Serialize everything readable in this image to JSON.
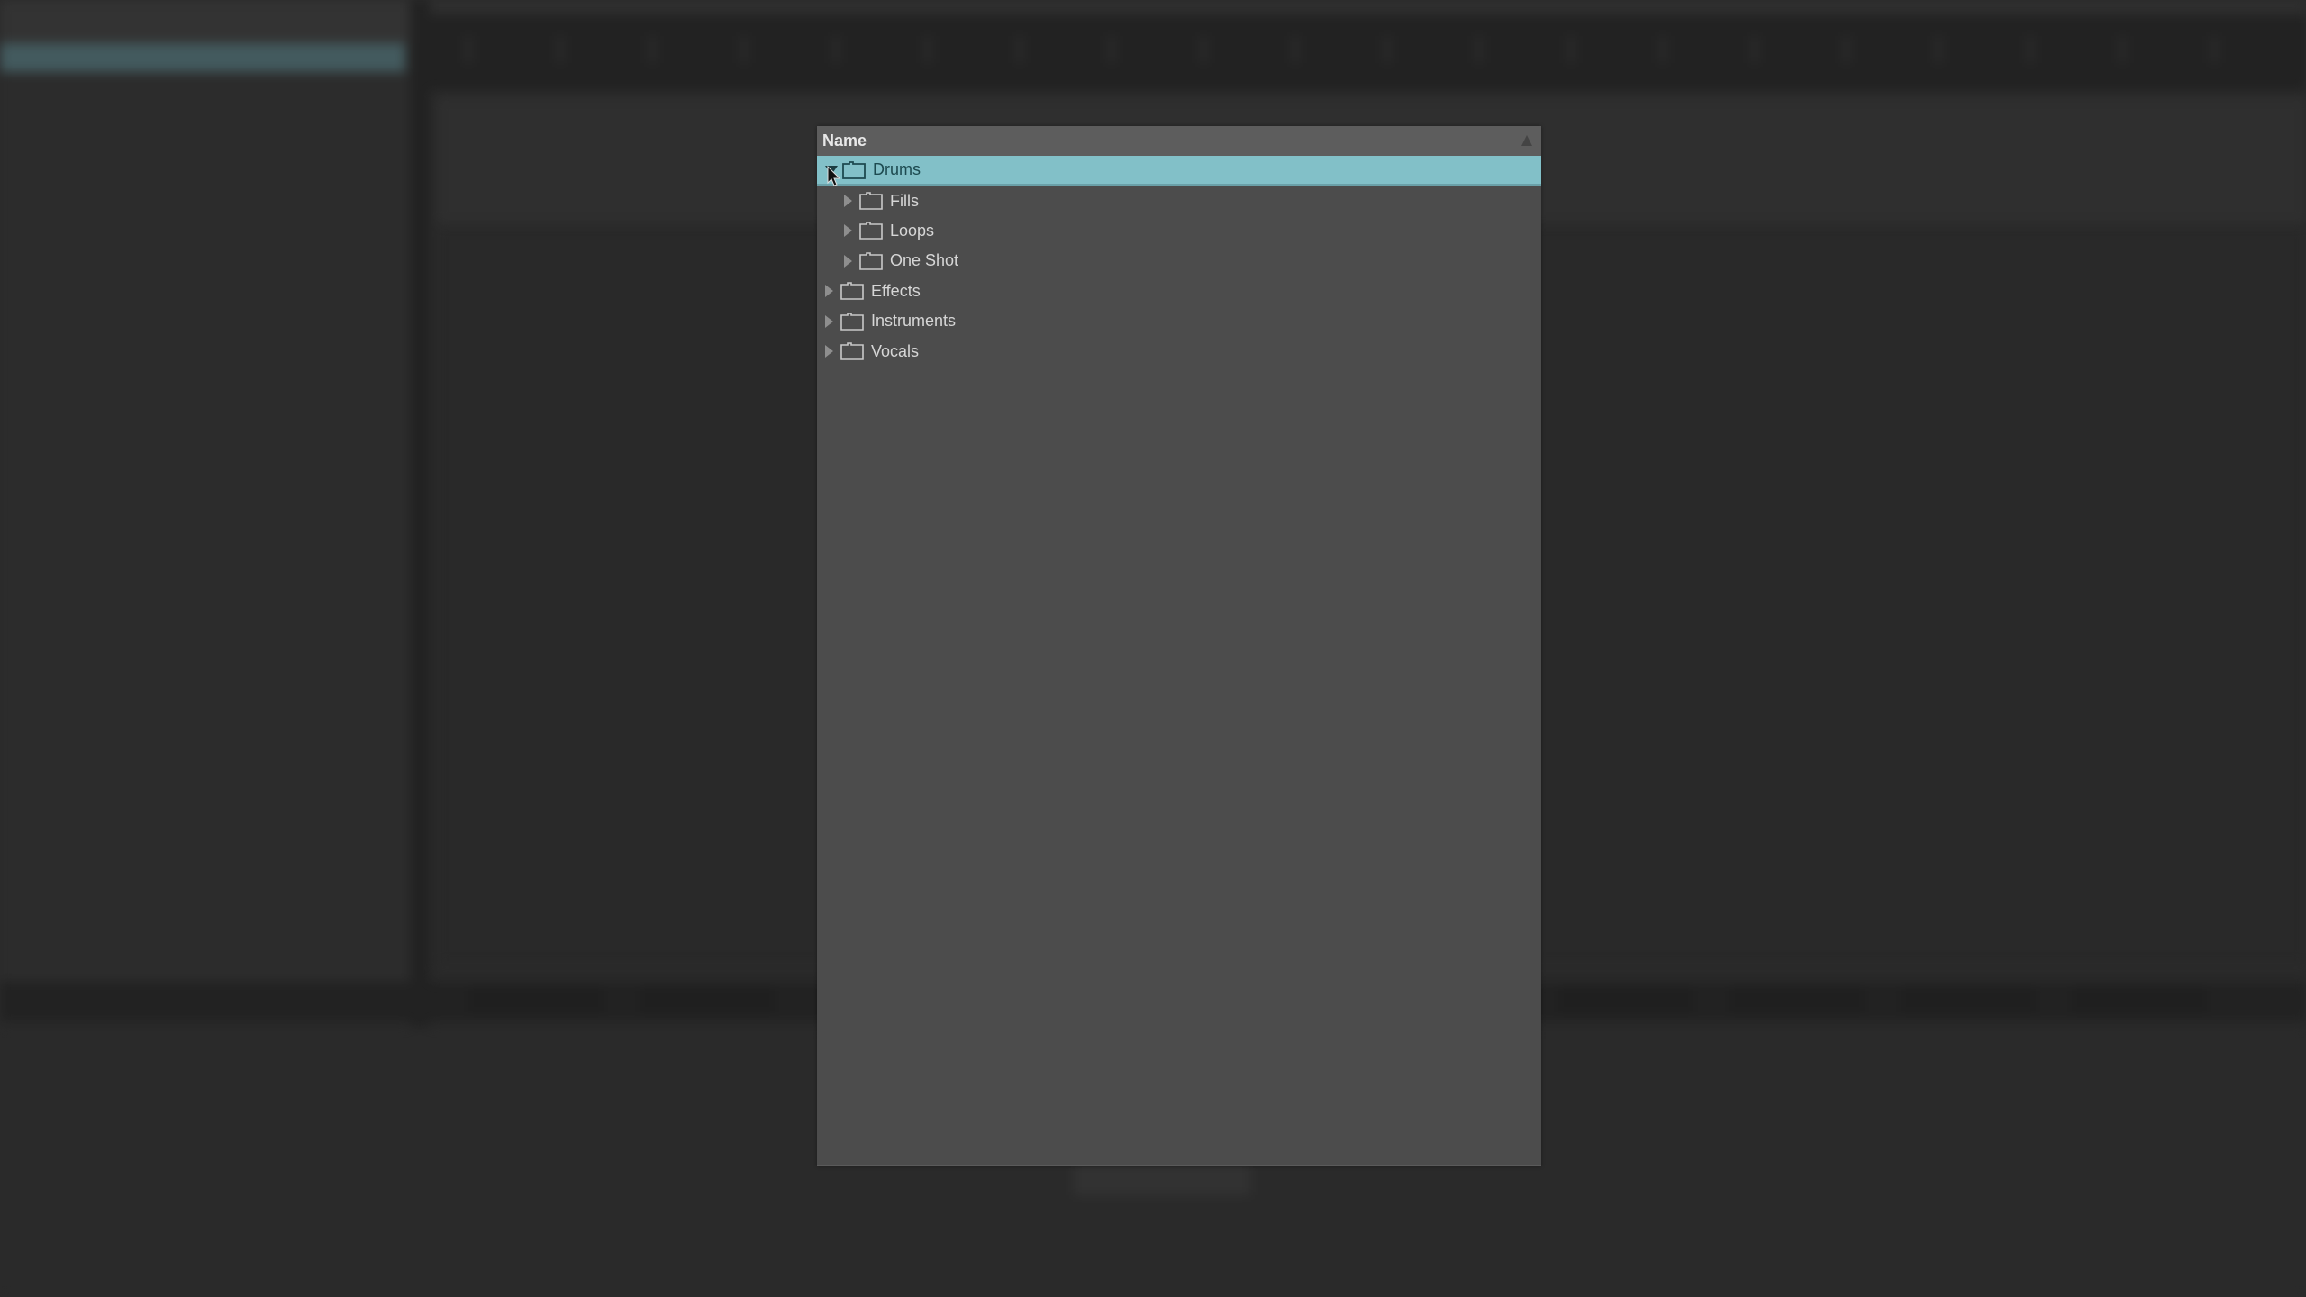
{
  "background": {
    "description": "blurred DAW window behind browser panel"
  },
  "browser": {
    "header": {
      "column_label": "Name",
      "sort_direction": "ascending"
    },
    "colors": {
      "selection": "#82c0c8",
      "selection_text": "#1d4a50",
      "panel": "#4c4c4c",
      "header": "#5d5d5d",
      "text": "#d6d6d6"
    },
    "items": [
      {
        "label": "Drums",
        "level": 0,
        "expanded": true,
        "selected": true,
        "icon": "folder-icon"
      },
      {
        "label": "Fills",
        "level": 1,
        "expanded": false,
        "selected": false,
        "icon": "folder-icon"
      },
      {
        "label": "Loops",
        "level": 1,
        "expanded": false,
        "selected": false,
        "icon": "folder-icon"
      },
      {
        "label": "One Shot",
        "level": 1,
        "expanded": false,
        "selected": false,
        "icon": "folder-icon"
      },
      {
        "label": "Effects",
        "level": 0,
        "expanded": false,
        "selected": false,
        "icon": "folder-icon"
      },
      {
        "label": "Instruments",
        "level": 0,
        "expanded": false,
        "selected": false,
        "icon": "folder-icon"
      },
      {
        "label": "Vocals",
        "level": 0,
        "expanded": false,
        "selected": false,
        "icon": "folder-icon"
      }
    ]
  }
}
